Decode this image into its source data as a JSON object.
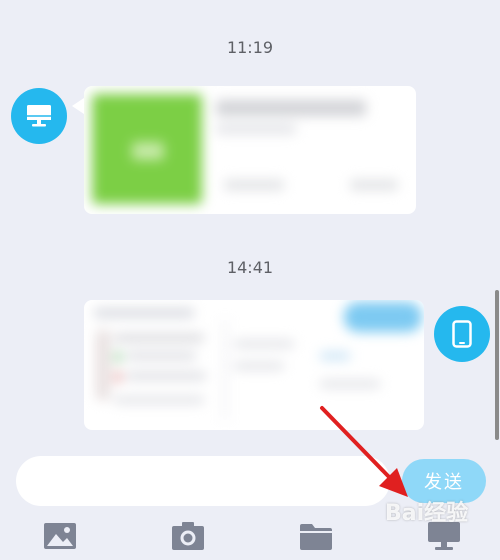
{
  "messages": [
    {
      "time": "11:19",
      "sender": "desktop",
      "type": "file",
      "avatar_icon": "monitor-icon"
    },
    {
      "time": "14:41",
      "sender": "phone",
      "type": "image",
      "avatar_icon": "phone-icon"
    }
  ],
  "composer": {
    "input_value": "",
    "send_label": "发送"
  },
  "toolbar": {
    "items": [
      "image-icon",
      "camera-icon",
      "folder-icon",
      "monitor-icon"
    ]
  },
  "colors": {
    "background": "#eceef6",
    "accent": "#25b8ee",
    "send_button": "#8fd8f8",
    "file_thumb": "#7ccf45",
    "annotation_arrow": "#e02020"
  },
  "watermark": "Bai经验"
}
